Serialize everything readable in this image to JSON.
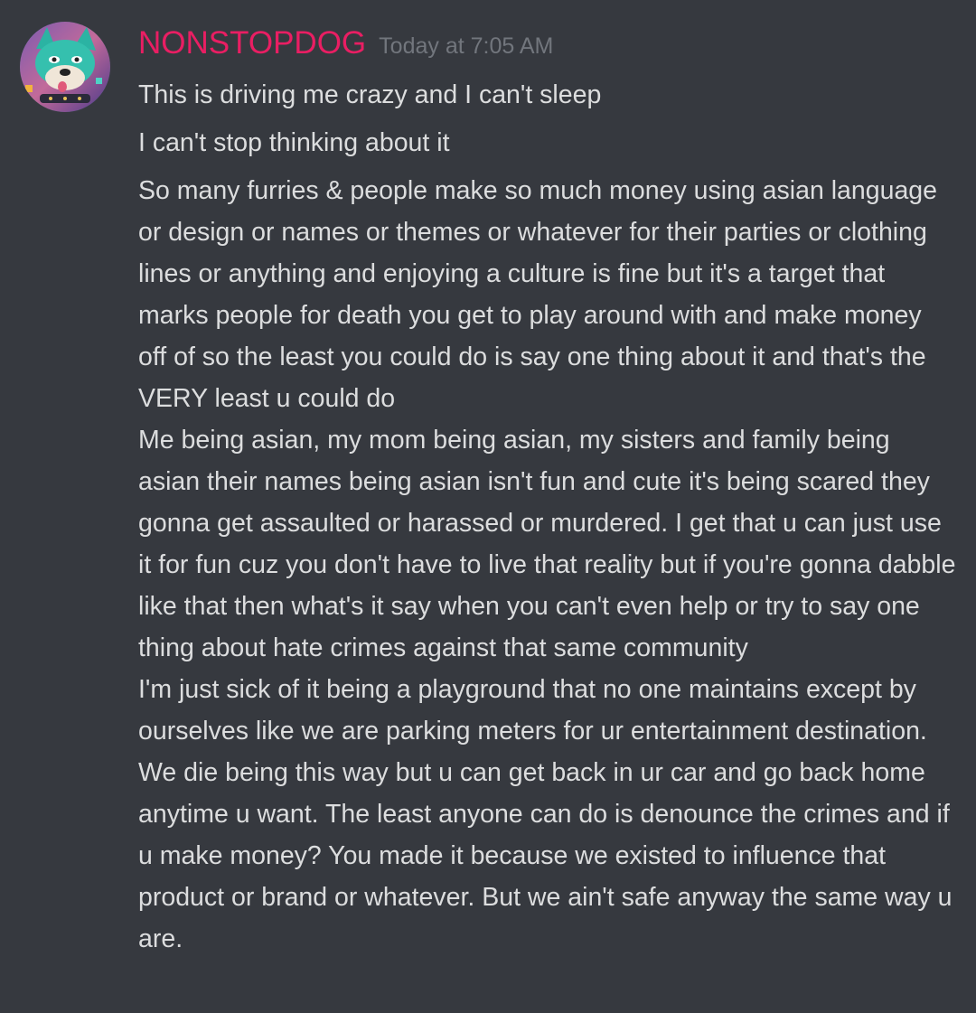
{
  "author": {
    "username": "NONSTOPDOG",
    "username_color": "#e91e63",
    "timestamp": "Today at 7:05 AM",
    "avatar_icon": "wolf-avatar-icon"
  },
  "colors": {
    "background": "#36393f",
    "text": "#dcddde",
    "timestamp": "#72767d"
  },
  "messages": [
    "This is driving me crazy and I can't sleep",
    "I can't stop thinking about it",
    "So many furries & people make so much money using asian language or design or names or themes or whatever for their parties or clothing lines or anything and enjoying a culture is fine but it's a target that marks people for death you get to play around with and make money off of so the least you could do is say one thing about it and that's the VERY least u could do",
    "Me being asian, my mom being asian, my sisters and family being asian their names being asian isn't fun and cute it's being scared they gonna get assaulted or harassed or murdered. I get that u can just use it for fun cuz you don't have to live that reality but if you're gonna dabble like that then what's it say when you can't even help or try to say one thing about hate crimes against that same community",
    "I'm just sick of it being a playground that no one maintains except by ourselves like we are parking meters for ur entertainment destination. We die being this way but u can get back in ur car and go back home anytime u want. The least anyone can do is denounce the crimes and if u make money? You made it because we existed to influence that product or brand or whatever. But we ain't safe anyway the same way u are."
  ]
}
